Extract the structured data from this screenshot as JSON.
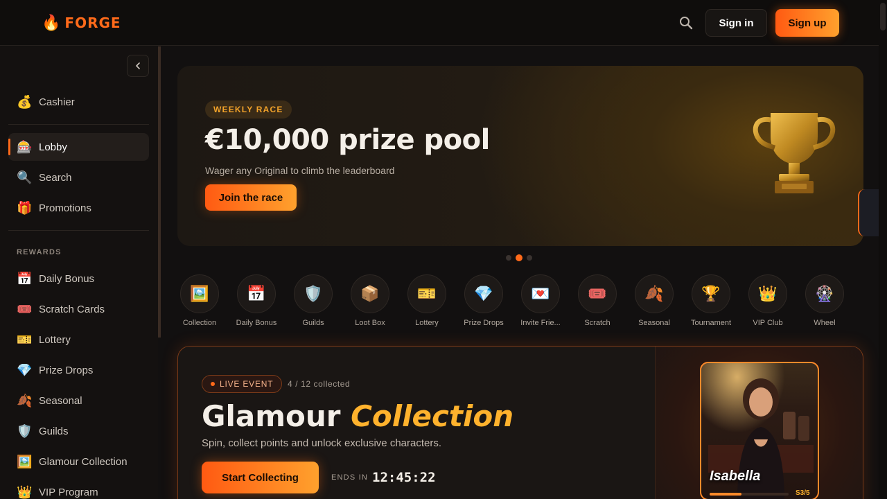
{
  "header": {
    "logo_text": "FORGE",
    "signin_label": "Sign in",
    "signup_label": "Sign up"
  },
  "sidebar": {
    "top_items": [
      {
        "label": "Cashier",
        "icon": "💰"
      }
    ],
    "nav_items": [
      {
        "label": "Lobby",
        "icon": "🎰",
        "active": true
      },
      {
        "label": "Search",
        "icon": "🔍"
      },
      {
        "label": "Promotions",
        "icon": "🎁"
      }
    ],
    "rewards_title": "REWARDS",
    "reward_items": [
      {
        "label": "Daily Bonus",
        "icon": "📅"
      },
      {
        "label": "Scratch Cards",
        "icon": "🎟️"
      },
      {
        "label": "Lottery",
        "icon": "🎫"
      },
      {
        "label": "Prize Drops",
        "icon": "💎"
      },
      {
        "label": "Seasonal",
        "icon": "🍂"
      },
      {
        "label": "Guilds",
        "icon": "🛡️"
      },
      {
        "label": "Glamour Collection",
        "icon": "🖼️"
      },
      {
        "label": "VIP Program",
        "icon": "👑"
      }
    ]
  },
  "hero": {
    "badge": "WEEKLY RACE",
    "title": "€10,000 prize pool",
    "subtitle": "Wager any Original to climb the leaderboard",
    "button": "Join the race",
    "slide_count": 3,
    "active_slide": 2
  },
  "categories": [
    {
      "label": "Collection",
      "icon": "🖼️"
    },
    {
      "label": "Daily Bonus",
      "icon": "📅"
    },
    {
      "label": "Guilds",
      "icon": "🛡️"
    },
    {
      "label": "Loot Box",
      "icon": "📦"
    },
    {
      "label": "Lottery",
      "icon": "🎫"
    },
    {
      "label": "Prize Drops",
      "icon": "💎"
    },
    {
      "label": "Invite Frie...",
      "icon": "💌"
    },
    {
      "label": "Scratch",
      "icon": "🎟️"
    },
    {
      "label": "Seasonal",
      "icon": "🍂"
    },
    {
      "label": "Tournament",
      "icon": "🏆"
    },
    {
      "label": "VIP Club",
      "icon": "👑"
    },
    {
      "label": "Wheel",
      "icon": "🎡"
    }
  ],
  "event": {
    "badge": "LIVE EVENT",
    "collected": "4 / 12 collected",
    "title_main": "Glamour",
    "title_highlight": "Collection",
    "subtitle": "Spin, collect points and unlock exclusive characters.",
    "button": "Start Collecting",
    "ends_label": "ENDS IN",
    "ends_time": "12:45:22",
    "character": {
      "name": "Isabella",
      "count": "S3/5",
      "progress": 0.4
    }
  },
  "colors": {
    "accent": "#ff6a1a",
    "accent_gold": "#ffb22d",
    "background": "#121010"
  }
}
